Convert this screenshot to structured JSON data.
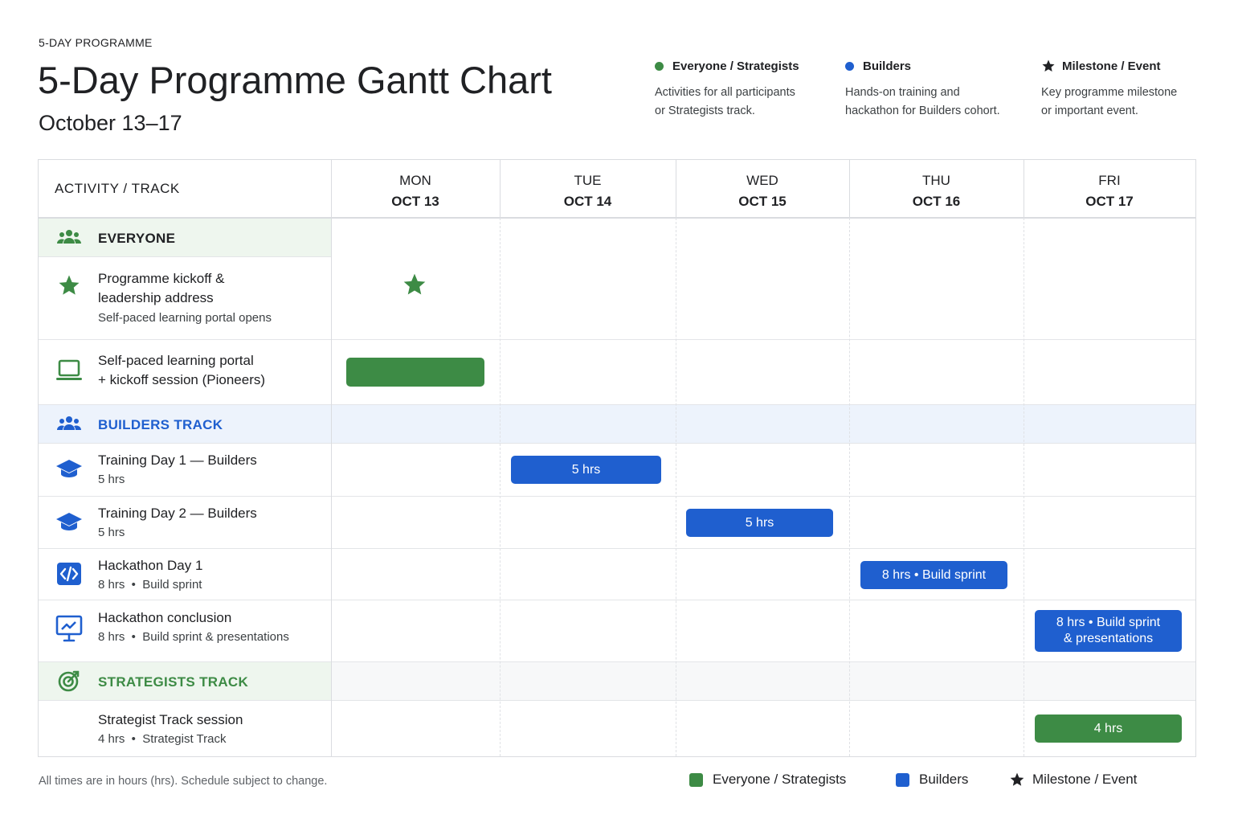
{
  "header": {
    "eyebrow": "5-DAY PROGRAMME",
    "title": "5-Day Programme Gantt Chart",
    "subtitle": "October 13–17"
  },
  "legend_top": [
    {
      "label": "Everyone / Strategists",
      "desc1": "Activities for all participants",
      "desc2": "or Strategists track.",
      "color": "#3d8b45"
    },
    {
      "label": "Builders",
      "desc1": "Hands-on training and",
      "desc2": "hackathon for Builders cohort.",
      "color": "#1f5fcf"
    },
    {
      "label": "Milestone / Event",
      "desc1": "Key programme milestone",
      "desc2": "or important event.",
      "color": "#202124"
    }
  ],
  "table": {
    "activity_header": "ACTIVITY / TRACK",
    "days": [
      {
        "name": "MON",
        "date": "OCT 13"
      },
      {
        "name": "TUE",
        "date": "OCT 14"
      },
      {
        "name": "WED",
        "date": "OCT 15"
      },
      {
        "name": "THU",
        "date": "OCT 16"
      },
      {
        "name": "FRI",
        "date": "OCT 17"
      }
    ],
    "sections": {
      "everyone": "EVERYONE",
      "builders": "BUILDERS TRACK",
      "strategists": "STRATEGISTS TRACK"
    },
    "rows": [
      {
        "title1": "Programme kickoff &",
        "title2": "leadership address",
        "sub": "Self-paced learning portal opens"
      },
      {
        "title1": "Self-paced learning portal",
        "title2": "+ kickoff session (Pioneers)",
        "sub": ""
      },
      {
        "title1": "Training Day 1 — Builders",
        "sub": "5 hrs"
      },
      {
        "title1": "Training Day 2 — Builders",
        "sub": "5 hrs"
      },
      {
        "title1": "Hackathon Day 1",
        "sub": "8 hrs  •  Build sprint"
      },
      {
        "title1": "Hackathon conclusion",
        "sub": "8 hrs  •  Build sprint & presentations"
      },
      {
        "title1": "Strategist Track session",
        "sub": "4 hrs  •  Strategist Track"
      }
    ]
  },
  "chart_data": {
    "type": "gantt",
    "title": "5-Day Programme Gantt Chart",
    "subtitle": "October 13–17",
    "categories": [
      "MON OCT 13",
      "TUE OCT 14",
      "WED OCT 15",
      "THU OCT 16",
      "FRI OCT 17"
    ],
    "tasks": [
      {
        "activity": "Programme kickoff & leadership address",
        "group": "Everyone",
        "day": "MON OCT 13",
        "kind": "milestone",
        "label": ""
      },
      {
        "activity": "Self-paced learning portal + kickoff session (Pioneers)",
        "group": "Everyone",
        "day": "MON OCT 13",
        "kind": "bar",
        "label": ""
      },
      {
        "activity": "Training Day 1 — Builders",
        "group": "Builders",
        "day": "TUE OCT 14",
        "kind": "bar",
        "hours": 5,
        "label": "5 hrs"
      },
      {
        "activity": "Training Day 2 — Builders",
        "group": "Builders",
        "day": "WED OCT 15",
        "kind": "bar",
        "hours": 5,
        "label": "5 hrs"
      },
      {
        "activity": "Hackathon Day 1",
        "group": "Builders",
        "day": "THU OCT 16",
        "kind": "bar",
        "hours": 8,
        "label": "8 hrs • Build sprint"
      },
      {
        "activity": "Hackathon conclusion",
        "group": "Builders",
        "day": "FRI OCT 17",
        "kind": "bar",
        "hours": 8,
        "label1": "8 hrs • Build sprint",
        "label2": "& presentations"
      },
      {
        "activity": "Strategist Track session",
        "group": "Strategists",
        "day": "FRI OCT 17",
        "kind": "bar",
        "hours": 4,
        "label": "4 hrs"
      }
    ],
    "colors": {
      "everyone_strategists": "#3d8b45",
      "builders": "#1f5fcf",
      "milestone": "#3d8b45"
    }
  },
  "legend_bottom": [
    {
      "label": "Everyone / Strategists",
      "color": "#3d8b45"
    },
    {
      "label": "Builders",
      "color": "#1f5fcf"
    },
    {
      "label": "Milestone / Event",
      "color": "#202124"
    }
  ],
  "footnote": "All times are in hours (hrs). Schedule subject to change."
}
